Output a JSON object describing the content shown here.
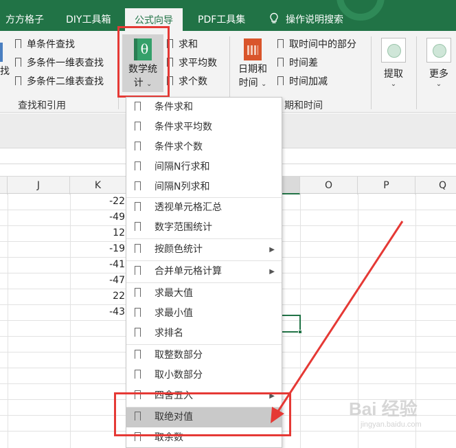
{
  "tabs": [
    {
      "label": "方方格子",
      "active": false
    },
    {
      "label": "DIY工具箱",
      "active": false
    },
    {
      "label": "公式向导",
      "active": true
    },
    {
      "label": "PDF工具集",
      "active": false
    },
    {
      "label": "操作说明搜索",
      "active": false,
      "icon": "lightbulb-icon"
    }
  ],
  "ribbon": {
    "lookup_items": [
      "单条件查找",
      "多条件一维表查找",
      "多条件二维表查找"
    ],
    "lookup_group_label": "查找和引用",
    "math_button": {
      "label_line1": "数学统",
      "label_line2": "计",
      "icon": "theta-icon"
    },
    "math_items": [
      "求和",
      "求平均数",
      "求个数"
    ],
    "date_button": {
      "label_line1": "日期和",
      "label_line2": "时间",
      "icon": "calendar-icon"
    },
    "date_items": [
      "取时间中的部分",
      "时间差",
      "时间加减"
    ],
    "date_group_label": "期和时间",
    "extract_label": "提取",
    "more_label": "更多"
  },
  "sheet": {
    "columns": [
      "J",
      "K",
      "O",
      "P",
      "Q"
    ],
    "selected_column": "",
    "k_values": [
      "-22",
      "-49",
      "12",
      "-19",
      "-41",
      "-47",
      "22",
      "-43"
    ]
  },
  "dropdown": {
    "items": [
      {
        "label": "条件求和",
        "has_submenu": false
      },
      {
        "label": "条件求平均数",
        "has_submenu": false
      },
      {
        "label": "条件求个数",
        "has_submenu": false
      },
      {
        "label": "间隔N行求和",
        "has_submenu": false
      },
      {
        "label": "间隔N列求和",
        "has_submenu": false
      },
      {
        "label": "透视单元格汇总",
        "has_submenu": false
      },
      {
        "label": "数字范围统计",
        "has_submenu": false
      },
      {
        "label": "按颜色统计",
        "has_submenu": true
      },
      {
        "label": "合并单元格计算",
        "has_submenu": true
      },
      {
        "label": "求最大值",
        "has_submenu": false
      },
      {
        "label": "求最小值",
        "has_submenu": false
      },
      {
        "label": "求排名",
        "has_submenu": false
      },
      {
        "label": "取整数部分",
        "has_submenu": false
      },
      {
        "label": "取小数部分",
        "has_submenu": false
      },
      {
        "label": "四舍五入",
        "has_submenu": true
      },
      {
        "label": "取绝对值",
        "has_submenu": false,
        "active": true
      },
      {
        "label": "取余数",
        "has_submenu": false
      }
    ]
  },
  "watermark": {
    "text": "Bai 经验",
    "sub": "jingyan.baidu.com"
  },
  "colors": {
    "brand": "#217346",
    "annotation": "#e53935",
    "menu_active": "#c9c9c9"
  }
}
